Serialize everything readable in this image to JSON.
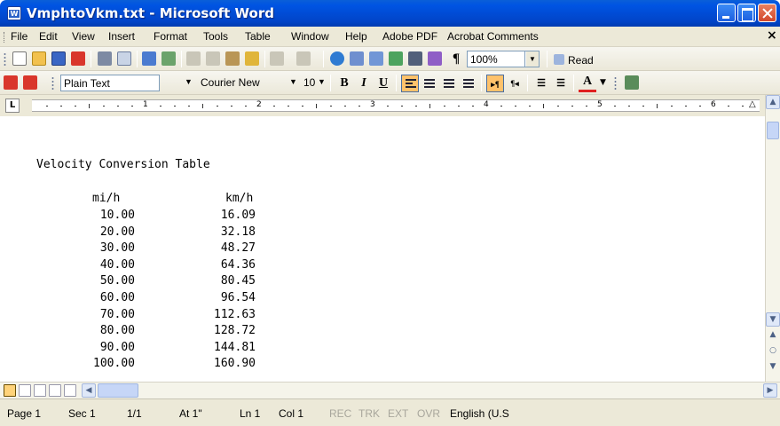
{
  "window": {
    "title": "VmphtoVkm.txt - Microsoft Word",
    "icon_text": "W"
  },
  "menu": {
    "items": [
      "File",
      "Edit",
      "View",
      "Insert",
      "Format",
      "Tools",
      "Table",
      "Window",
      "Help",
      "Adobe PDF",
      "Acrobat Comments"
    ],
    "close_glyph": "×"
  },
  "toolbar_standard": {
    "zoom": "100%",
    "read_label": "Read",
    "pilcrow": "¶"
  },
  "toolbar_formatting": {
    "style": "Plain Text",
    "font": "Courier New",
    "size": "10",
    "bold": "B",
    "italic": "I",
    "underline": "U",
    "font_color_letter": "A",
    "align_left_active": true
  },
  "ruler": {
    "numbers": [
      "1",
      "2",
      "3",
      "4",
      "5",
      "6"
    ]
  },
  "document": {
    "heading": "Velocity Conversion Table",
    "columns": [
      "mi/h",
      "km/h"
    ],
    "rows": [
      [
        "10.00",
        "16.09"
      ],
      [
        "20.00",
        "32.18"
      ],
      [
        "30.00",
        "48.27"
      ],
      [
        "40.00",
        "64.36"
      ],
      [
        "50.00",
        "80.45"
      ],
      [
        "60.00",
        "96.54"
      ],
      [
        "70.00",
        "112.63"
      ],
      [
        "80.00",
        "128.72"
      ],
      [
        "90.00",
        "144.81"
      ],
      [
        "100.00",
        "160.90"
      ]
    ]
  },
  "status": {
    "page": "Page 1",
    "sec": "Sec 1",
    "pages": "1/1",
    "at": "At 1\"",
    "ln": "Ln 1",
    "col": "Col 1",
    "rec": "REC",
    "trk": "TRK",
    "ext": "EXT",
    "ovr": "OVR",
    "language": "English (U.S"
  },
  "colors": {
    "titlebar": "#0054e3",
    "chrome": "#ece9d8",
    "active_button": "#ffc26b"
  }
}
